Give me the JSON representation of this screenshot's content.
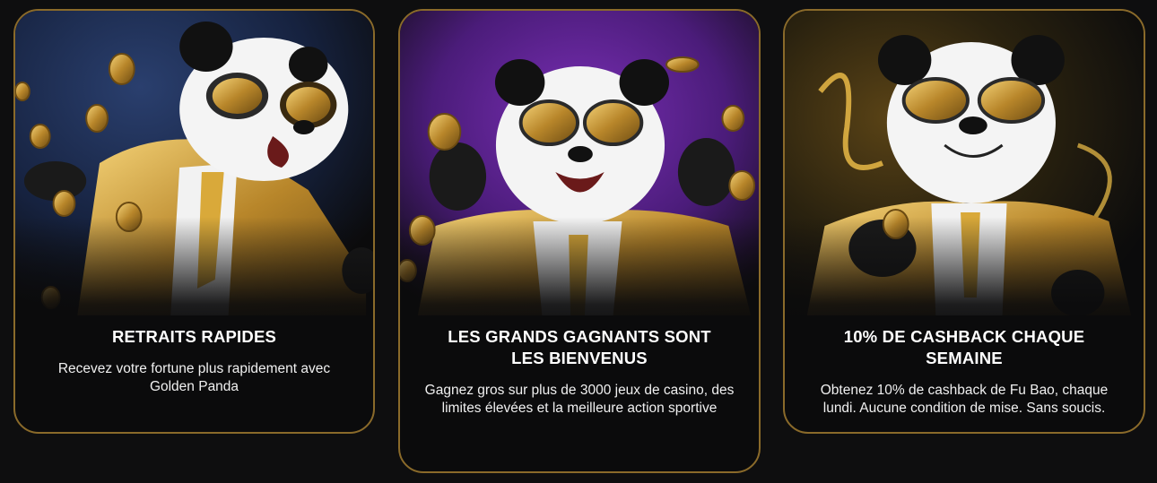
{
  "colors": {
    "background": "#0e0e0f",
    "card_border": "#8a6a2a",
    "gold": "#d4a63a",
    "text": "#ffffff"
  },
  "cards": [
    {
      "title": "RETRAITS RAPIDES",
      "description": "Recevez votre fortune plus rapidement avec Golden Panda",
      "image_icon": "panda-flying-coins-illustration",
      "background_color": "#16223f"
    },
    {
      "title": "LES GRANDS GAGNANTS SONT LES BIENVENUS",
      "description": "Gagnez gros sur plus de 3000 jeux de casino, des limites élevées et la meilleure action sportive",
      "image_icon": "panda-celebrating-illustration",
      "background_color": "#4b1c7a"
    },
    {
      "title": "10% DE CASHBACK CHAQUE SEMAINE",
      "description": "Obtenez 10% de cashback de Fu Bao, chaque lundi. Aucune condition de mise. Sans soucis.",
      "image_icon": "panda-holding-coin-illustration",
      "background_color": "#2a220f"
    }
  ]
}
